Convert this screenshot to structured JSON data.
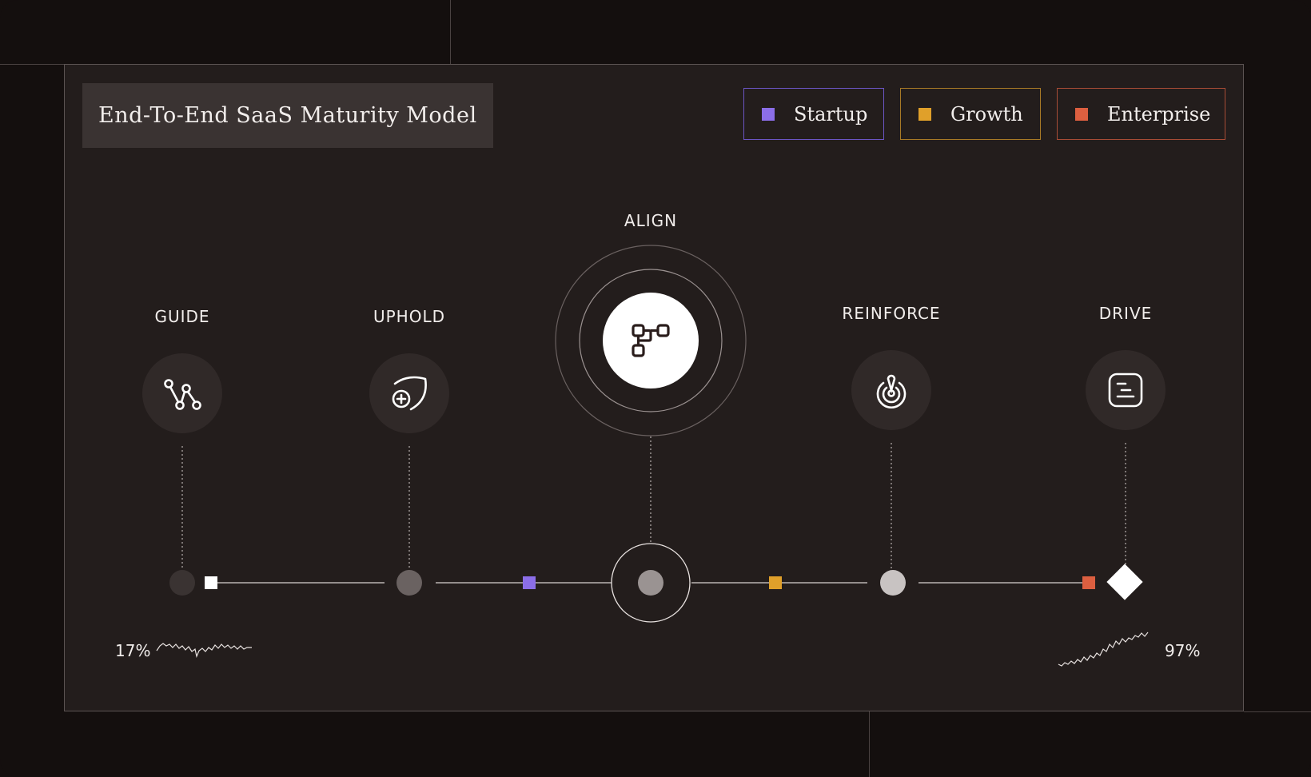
{
  "title": "End-To-End SaaS Maturity Model",
  "legend": [
    {
      "label": "Startup",
      "color": "#8b6ee8"
    },
    {
      "label": "Growth",
      "color": "#e0a02a"
    },
    {
      "label": "Enterprise",
      "color": "#dc5f40"
    }
  ],
  "stages": [
    {
      "label": "GUIDE",
      "icon": "nodes-path-icon"
    },
    {
      "label": "UPHOLD",
      "icon": "shield-plus-icon"
    },
    {
      "label": "ALIGN",
      "icon": "flow-branch-icon"
    },
    {
      "label": "REINFORCE",
      "icon": "target-pin-icon"
    },
    {
      "label": "DRIVE",
      "icon": "chat-lines-icon"
    }
  ],
  "metrics": {
    "start_percent": "17%",
    "end_percent": "97%"
  }
}
